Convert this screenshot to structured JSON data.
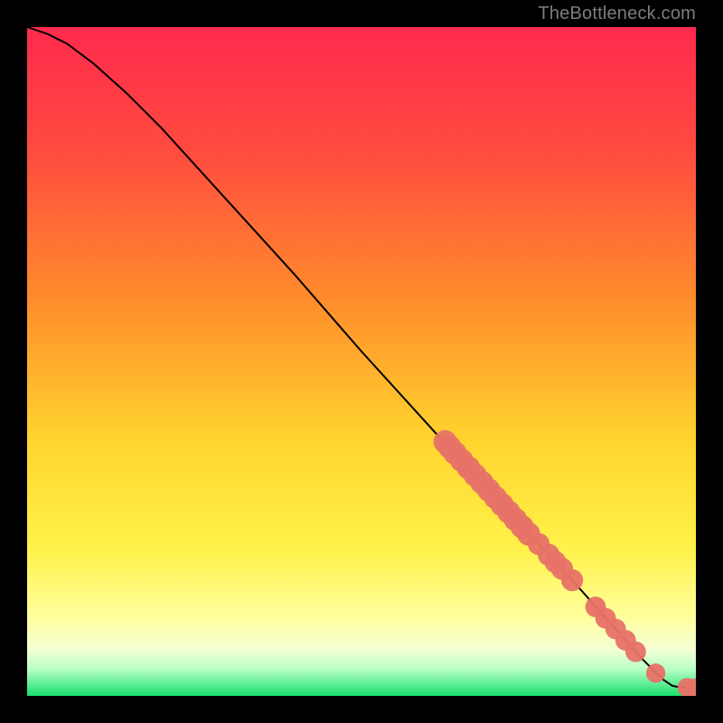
{
  "attribution": "TheBottleneck.com",
  "colors": {
    "black": "#000000",
    "curve": "#000000",
    "point_fill": "#e77267",
    "grad_top": "#ff2a4d",
    "grad_mid_fiery": "#ff5a3c",
    "grad_orange": "#ff9a2a",
    "grad_yellow": "#ffe233",
    "grad_pale": "#ffffb0",
    "grad_mint": "#b8ffc6",
    "grad_green": "#18e06c"
  },
  "chart_data": {
    "type": "line",
    "xlim": [
      0,
      100
    ],
    "ylim": [
      0,
      100
    ],
    "xlabel": "",
    "ylabel": "",
    "title": "",
    "curve": [
      {
        "x": 0,
        "y": 100
      },
      {
        "x": 3,
        "y": 99
      },
      {
        "x": 6,
        "y": 97.5
      },
      {
        "x": 10,
        "y": 94.5
      },
      {
        "x": 15,
        "y": 90
      },
      {
        "x": 20,
        "y": 85
      },
      {
        "x": 30,
        "y": 74
      },
      {
        "x": 40,
        "y": 63
      },
      {
        "x": 50,
        "y": 51.5
      },
      {
        "x": 60,
        "y": 40.5
      },
      {
        "x": 70,
        "y": 29.5
      },
      {
        "x": 80,
        "y": 19
      },
      {
        "x": 88,
        "y": 10
      },
      {
        "x": 92,
        "y": 5.5
      },
      {
        "x": 95,
        "y": 2.5
      },
      {
        "x": 96.5,
        "y": 1.5
      },
      {
        "x": 97.5,
        "y": 1.3
      },
      {
        "x": 100,
        "y": 1.2
      }
    ],
    "series": [
      {
        "name": "cluster-points",
        "points": [
          {
            "x": 62.5,
            "y": 38,
            "r": 1.2
          },
          {
            "x": 63.2,
            "y": 37.2,
            "r": 1.2
          },
          {
            "x": 64.0,
            "y": 36.3,
            "r": 1.2
          },
          {
            "x": 65.0,
            "y": 35.2,
            "r": 1.2
          },
          {
            "x": 66.0,
            "y": 34.1,
            "r": 1.2
          },
          {
            "x": 67.0,
            "y": 33.0,
            "r": 1.2
          },
          {
            "x": 68.0,
            "y": 31.9,
            "r": 1.2
          },
          {
            "x": 69.0,
            "y": 30.8,
            "r": 1.2
          },
          {
            "x": 70.0,
            "y": 29.7,
            "r": 1.2
          },
          {
            "x": 71.0,
            "y": 28.6,
            "r": 1.2
          },
          {
            "x": 72.0,
            "y": 27.5,
            "r": 1.2
          },
          {
            "x": 73.0,
            "y": 26.4,
            "r": 1.2
          },
          {
            "x": 74.0,
            "y": 25.3,
            "r": 1.2
          },
          {
            "x": 75.0,
            "y": 24.2,
            "r": 1.2
          },
          {
            "x": 76.5,
            "y": 22.7,
            "r": 1.1
          },
          {
            "x": 78.0,
            "y": 21.1,
            "r": 1.1
          },
          {
            "x": 79.0,
            "y": 20.0,
            "r": 1.1
          },
          {
            "x": 80.0,
            "y": 19.0,
            "r": 1.1
          },
          {
            "x": 81.5,
            "y": 17.3,
            "r": 1.1
          },
          {
            "x": 85.0,
            "y": 13.3,
            "r": 1.0
          },
          {
            "x": 86.5,
            "y": 11.6,
            "r": 1.0
          },
          {
            "x": 88.0,
            "y": 10.0,
            "r": 1.0
          },
          {
            "x": 89.5,
            "y": 8.3,
            "r": 1.0
          },
          {
            "x": 91.0,
            "y": 6.6,
            "r": 1.0
          },
          {
            "x": 94.0,
            "y": 3.4,
            "r": 0.9
          },
          {
            "x": 98.7,
            "y": 1.25,
            "r": 0.9
          },
          {
            "x": 100,
            "y": 1.2,
            "r": 0.9
          }
        ]
      }
    ]
  }
}
